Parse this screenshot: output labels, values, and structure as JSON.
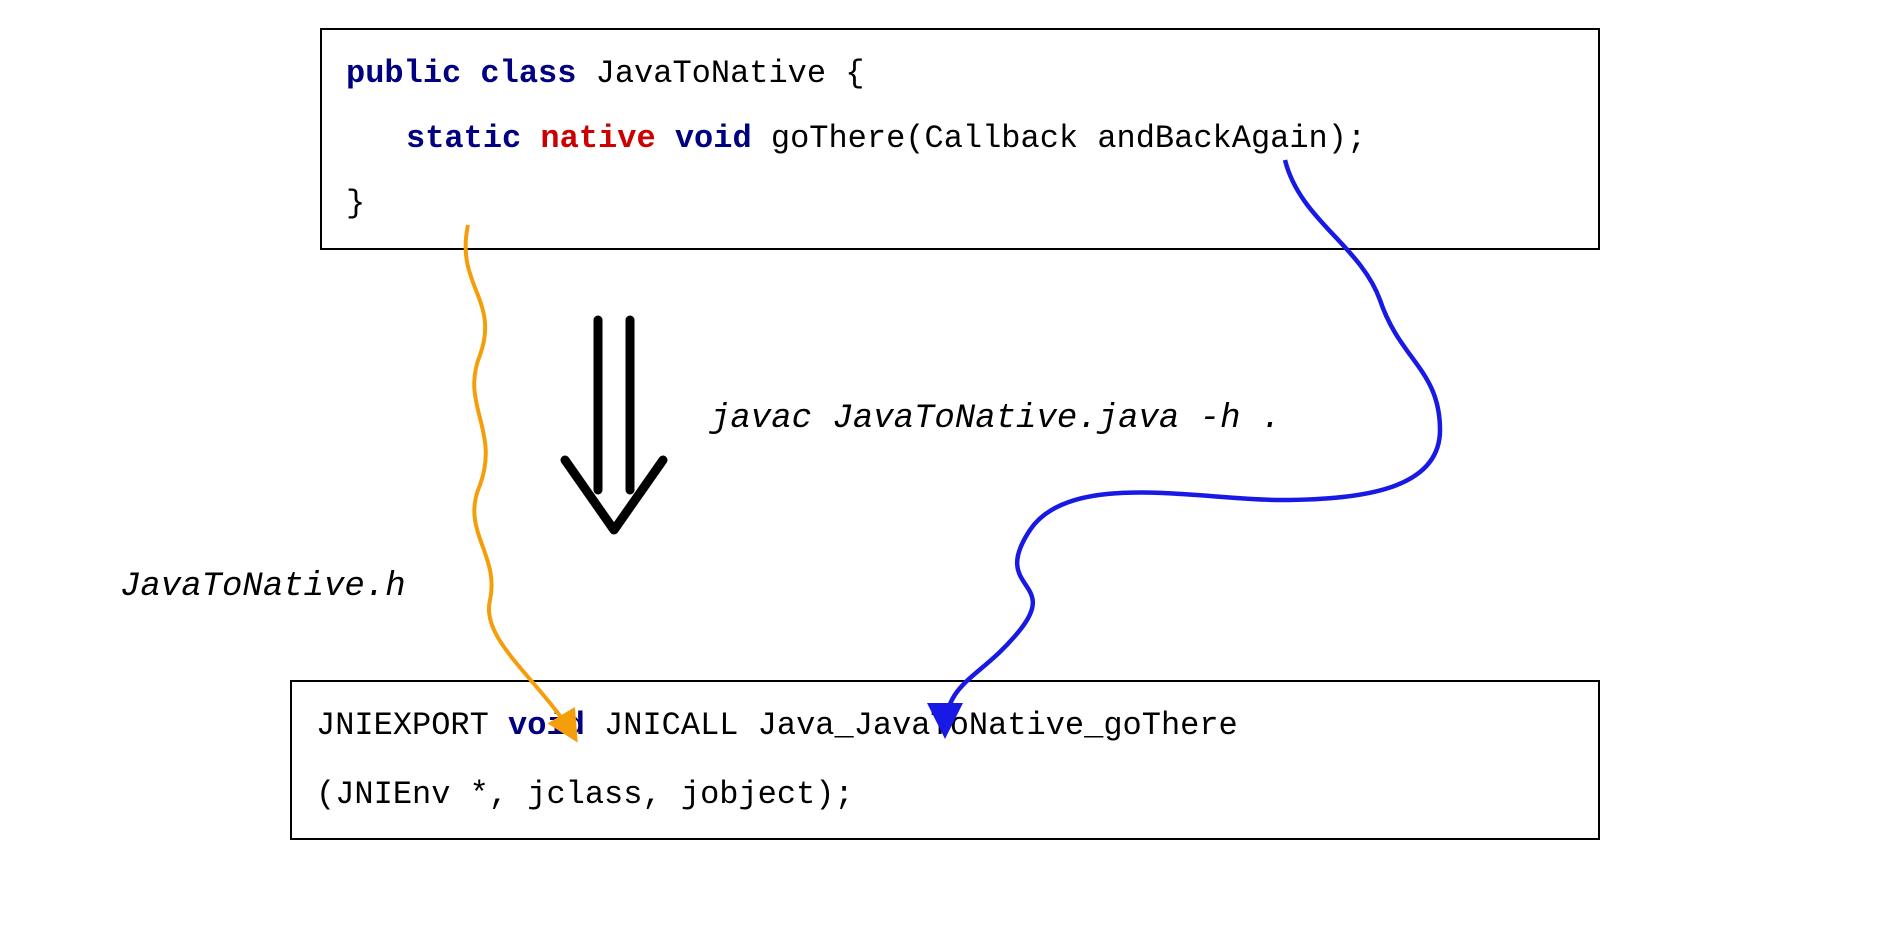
{
  "topBox": {
    "line1": {
      "kw1": "public",
      "kw2": "class",
      "className": "JavaToNative {"
    },
    "line2": {
      "kw1": "static",
      "kw2": "native",
      "kw3": "void",
      "method": "goThere(Callback andBackAgain);"
    },
    "line3": "}"
  },
  "command": "javac JavaToNative.java -h .",
  "fileLabel": "JavaToNative.h",
  "bottomBox": {
    "line1": {
      "part1": "JNIEXPORT ",
      "kw": "void",
      "part2": " JNICALL Java_JavaToNative_goThere"
    },
    "line2": " (JNIEnv *, jclass, jobject);"
  },
  "colors": {
    "orange": "#f59e0b",
    "blue": "#1919e6",
    "black": "#000000"
  }
}
